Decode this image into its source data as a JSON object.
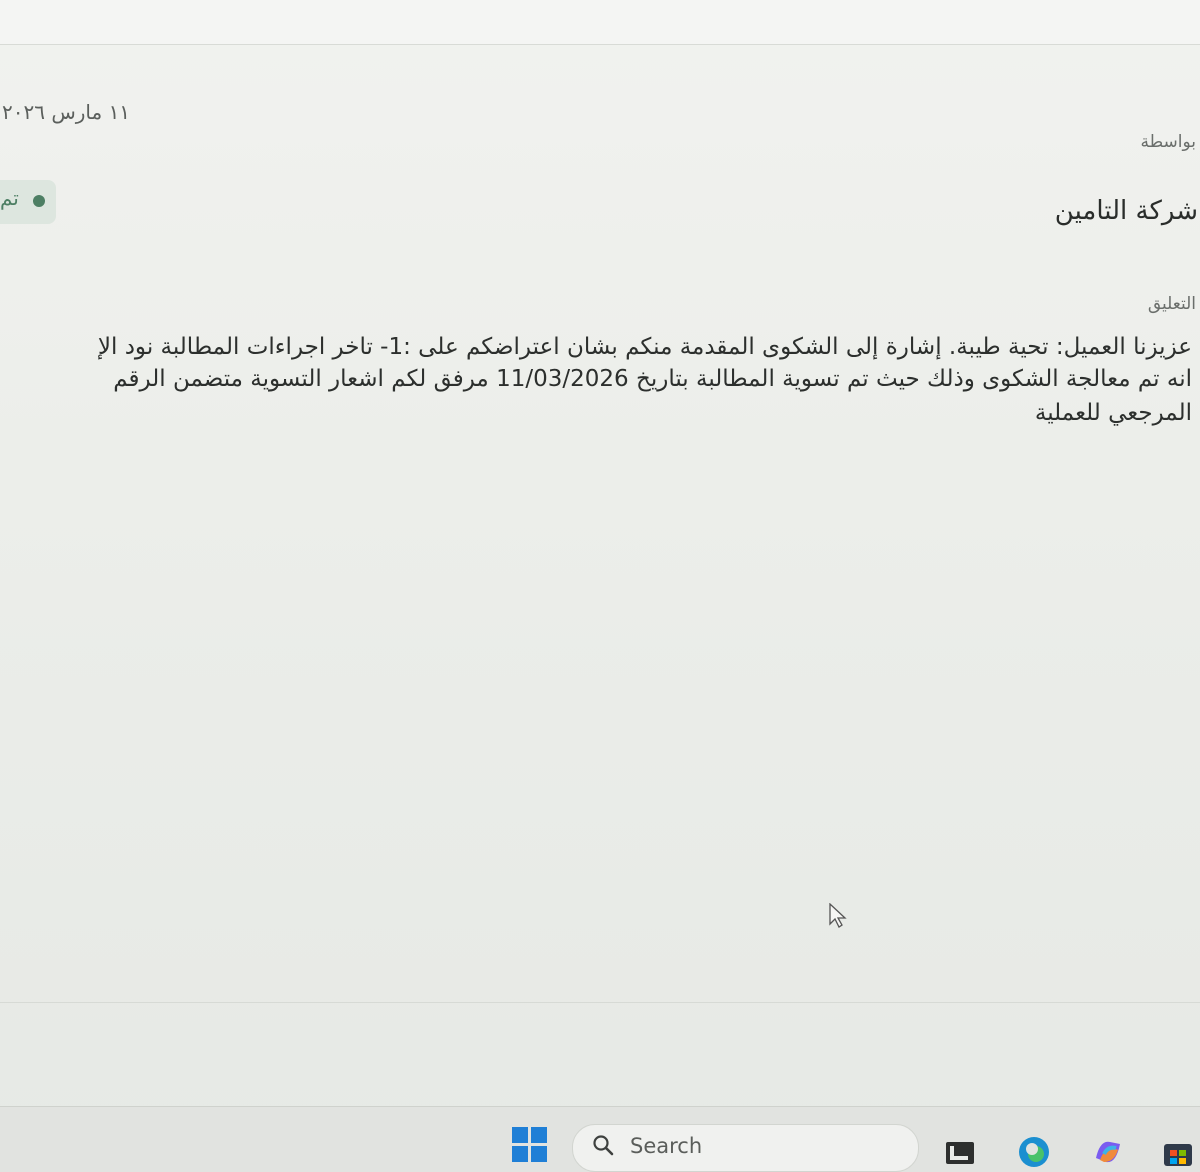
{
  "message": {
    "date": "١١ مارس ٢٠٢٦",
    "via_label": "بواسطة",
    "status_text": "تم",
    "company_name": "شركة التامين",
    "comment_label": "التعليق",
    "comment_lines": [
      "عزيزنا العميل: تحية طيبة. إشارة إلى الشكوى المقدمة منكم بشان اعتراضكم على :1- تاخر اجراءات المطالبة نود الإ",
      "انه تم معالجة الشكوى وذلك حيث تم تسوية المطالبة بتاريخ 11/03/2026 مرفق لكم اشعار التسوية متضمن الرقم",
      "المرجعي للعملية"
    ]
  },
  "taskbar": {
    "search_placeholder": "Search",
    "icons": [
      "windows-start-icon",
      "search-icon",
      "file-explorer-icon",
      "edge-browser-icon",
      "copilot-icon",
      "store-icon"
    ]
  },
  "colors": {
    "status_green": "#4d7f64",
    "windows_blue": "#1f7fd6"
  }
}
